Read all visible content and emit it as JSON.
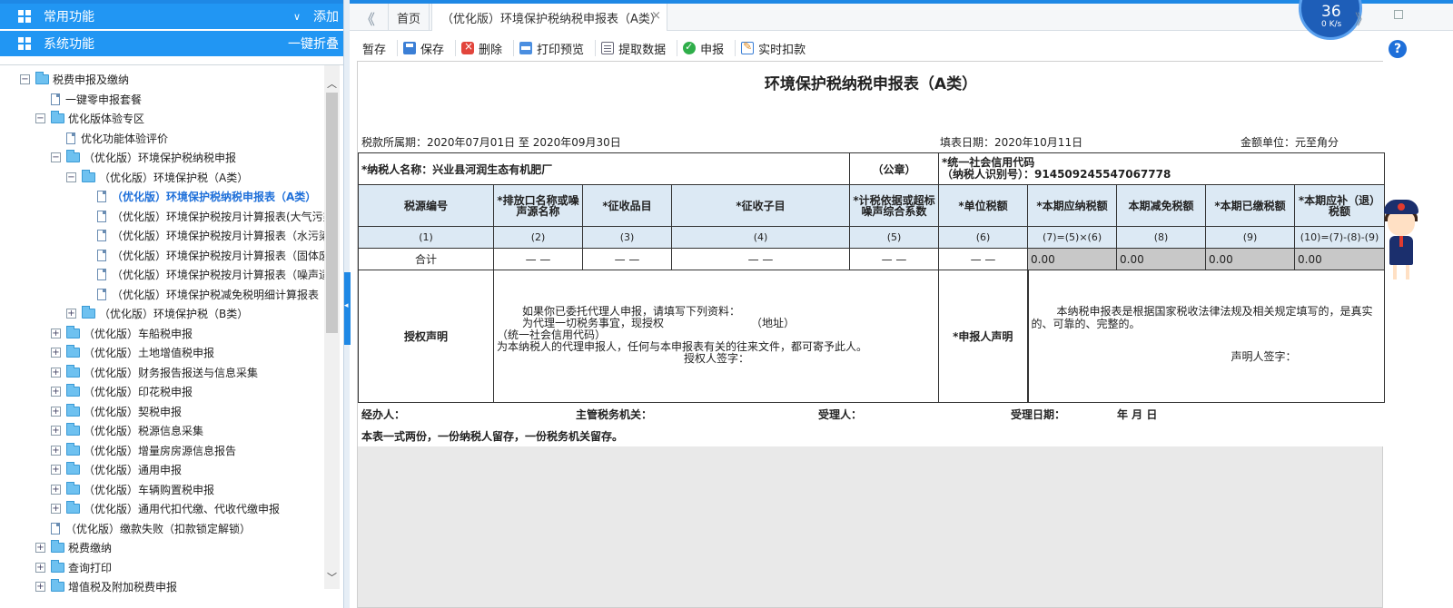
{
  "sidebar": {
    "common_title": "常用功能",
    "common_add": "添加",
    "system_title": "系统功能",
    "collapse_all": "一键折叠",
    "tree": [
      {
        "label": "税费申报及缴纳",
        "toggle": "−",
        "icon": "folder"
      },
      {
        "label": "一键零申报套餐",
        "icon": "doc"
      },
      {
        "label": "优化版体验专区",
        "toggle": "−",
        "icon": "folder"
      },
      {
        "label": "优化功能体验评价",
        "icon": "doc"
      },
      {
        "label": "（优化版）环境保护税纳税申报",
        "toggle": "−",
        "icon": "folder"
      },
      {
        "label": "（优化版）环境保护税（A类）",
        "toggle": "−",
        "icon": "folder"
      },
      {
        "label": "（优化版）环境保护税纳税申报表（A类）",
        "icon": "doc",
        "active": true
      },
      {
        "label": "（优化版）环境保护税按月计算报表(大气污染物",
        "icon": "doc"
      },
      {
        "label": "（优化版）环境保护税按月计算报表（水污染物",
        "icon": "doc"
      },
      {
        "label": "（优化版）环境保护税按月计算报表（固体废物",
        "icon": "doc"
      },
      {
        "label": "（优化版）环境保护税按月计算报表（噪声适用",
        "icon": "doc"
      },
      {
        "label": "（优化版）环境保护税减免税明细计算报表",
        "icon": "doc"
      },
      {
        "label": "（优化版）环境保护税（B类）",
        "toggle": "+",
        "icon": "folder"
      },
      {
        "label": "（优化版）车船税申报",
        "toggle": "+",
        "icon": "folder"
      },
      {
        "label": "（优化版）土地增值税申报",
        "toggle": "+",
        "icon": "folder"
      },
      {
        "label": "（优化版）财务报告报送与信息采集",
        "toggle": "+",
        "icon": "folder"
      },
      {
        "label": "（优化版）印花税申报",
        "toggle": "+",
        "icon": "folder"
      },
      {
        "label": "（优化版）契税申报",
        "toggle": "+",
        "icon": "folder"
      },
      {
        "label": "（优化版）税源信息采集",
        "toggle": "+",
        "icon": "folder"
      },
      {
        "label": "（优化版）增量房房源信息报告",
        "toggle": "+",
        "icon": "folder"
      },
      {
        "label": "（优化版）通用申报",
        "toggle": "+",
        "icon": "folder"
      },
      {
        "label": "（优化版）车辆购置税申报",
        "toggle": "+",
        "icon": "folder"
      },
      {
        "label": "（优化版）通用代扣代缴、代收代缴申报",
        "toggle": "+",
        "icon": "folder"
      },
      {
        "label": "（优化版）缴款失败（扣款锁定解锁）",
        "icon": "doc"
      },
      {
        "label": "税费缴纳",
        "toggle": "+",
        "icon": "folder"
      },
      {
        "label": "查询打印",
        "toggle": "+",
        "icon": "folder"
      },
      {
        "label": "增值税及附加税费申报",
        "toggle": "+",
        "icon": "folder"
      }
    ]
  },
  "tabs": {
    "home": "首页",
    "current": "（优化版）环境保护税纳税申报表（A类）",
    "close": "×",
    "back": "《",
    "forward": "》",
    "speed_pct": "36",
    "speed_rate": "0 K/s"
  },
  "toolbar": {
    "items": [
      {
        "label": "暂存",
        "icon": "none"
      },
      {
        "label": "保存",
        "icon": "save"
      },
      {
        "label": "删除",
        "icon": "delete"
      },
      {
        "label": "打印预览",
        "icon": "print"
      },
      {
        "label": "提取数据",
        "icon": "fetch"
      },
      {
        "label": "申报",
        "icon": "ok"
      },
      {
        "label": "实时扣款",
        "icon": "deduct"
      }
    ],
    "help": "?"
  },
  "form": {
    "title": "环境保护税纳税申报表（A类）",
    "period": "税款所属期：2020年07月01日  至  2020年09月30日",
    "fill_date": "填表日期：2020年10月11日",
    "unit": "金额单位：元至角分",
    "taxpayer_name": "*纳税人名称：兴业县河润生态有机肥厂",
    "seal": "（公章）",
    "credit_code_label": "*统一社会信用代码",
    "credit_code": "（纳税人识别号）：914509245547067778",
    "headers": [
      "税源编号",
      "*排放口名称或噪声源名称",
      "*征收品目",
      "*征收子目",
      "*计税依据或超标噪声综合系数",
      "*单位税额",
      "*本期应纳税额",
      "本期减免税额",
      "*本期已缴税额",
      "*本期应补（退）税额"
    ],
    "col_numbers": [
      "(1)",
      "(2)",
      "(3)",
      "(4)",
      "(5)",
      "(6)",
      "(7)=(5)×(6)",
      "(8)",
      "(9)",
      "(10)=(7)-(8)-(9)"
    ],
    "total_label": "合计",
    "total_dashes": [
      "— —",
      "— —",
      "— —",
      "— —",
      "— —"
    ],
    "total_values": [
      "0.00",
      "0.00",
      "0.00",
      "0.00"
    ],
    "auth_label": "授权声明",
    "auth_text_1": "如果你已委托代理人申报，请填写下列资料：",
    "auth_text_2": "为代理一切税务事宜，现授权",
    "auth_text_3": "（地址）",
    "auth_text_4": "（统一社会信用代码）",
    "auth_text_5": "为本纳税人的代理申报人，任何与本申报表有关的往来文件，都可寄予此人。",
    "auth_sign": "授权人签字：",
    "decl_label": "*申报人声明",
    "decl_text": "本纳税申报表是根据国家税收法律法规及相关规定填写的，是真实的、可靠的、完整的。",
    "decl_sign": "声明人签字：",
    "handler": "经办人：",
    "tax_authority": "主管税务机关：",
    "receiver": "受理人：",
    "receive_date": "受理日期：",
    "ymd": "年        月        日",
    "footnote": "本表一式两份，一份纳税人留存，一份税务机关留存。"
  }
}
